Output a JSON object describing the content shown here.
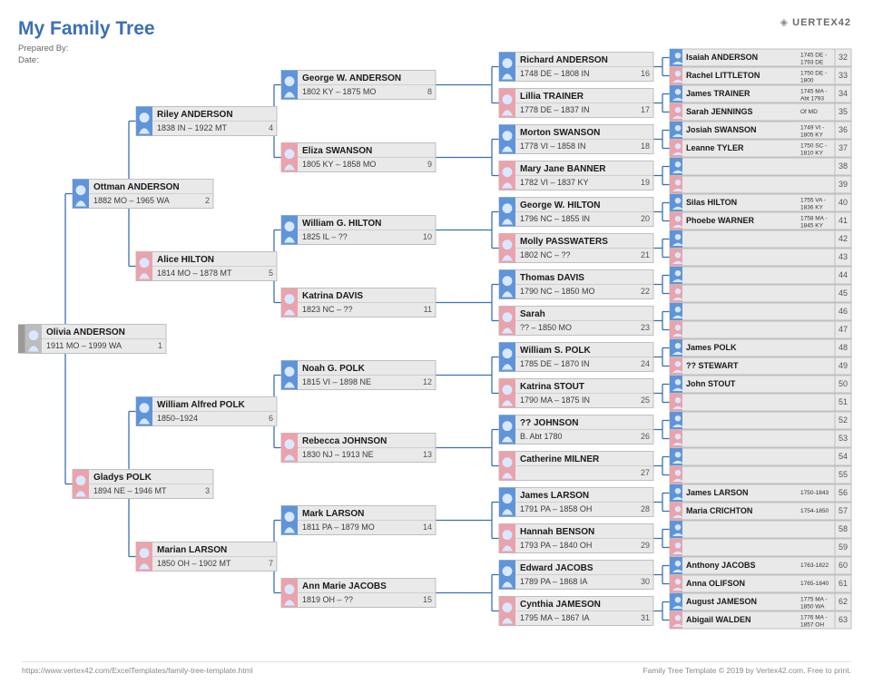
{
  "title": "My Family Tree",
  "meta": {
    "prepared_by_label": "Prepared By:",
    "date_label": "Date:"
  },
  "logo": "UERTEX42",
  "footer_left": "https://www.vertex42.com/ExcelTemplates/family-tree-template.html",
  "footer_right": "Family Tree Template © 2019 by Vertex42.com. Free to print.",
  "gen1": [
    {
      "id": 1,
      "name": "Olivia ANDERSON",
      "dates": "1911 MO – 1999 WA",
      "sex": "n"
    }
  ],
  "gen2": [
    {
      "id": 2,
      "name": "Ottman ANDERSON",
      "dates": "1882 MO – 1965 WA",
      "sex": "m"
    },
    {
      "id": 3,
      "name": "Gladys POLK",
      "dates": "1894 NE – 1946 MT",
      "sex": "f"
    }
  ],
  "gen3": [
    {
      "id": 4,
      "name": "Riley ANDERSON",
      "dates": "1838 IN – 1922 MT",
      "sex": "m"
    },
    {
      "id": 5,
      "name": "Alice HILTON",
      "dates": "1814 MO – 1878 MT",
      "sex": "f"
    },
    {
      "id": 6,
      "name": "William Alfred POLK",
      "dates": "1850–1924",
      "sex": "m"
    },
    {
      "id": 7,
      "name": "Marian LARSON",
      "dates": "1850 OH – 1902 MT",
      "sex": "f"
    }
  ],
  "gen4": [
    {
      "id": 8,
      "name": "George W. ANDERSON",
      "dates": "1802 KY – 1875 MO",
      "sex": "m"
    },
    {
      "id": 9,
      "name": "Eliza SWANSON",
      "dates": "1805 KY – 1858 MO",
      "sex": "f"
    },
    {
      "id": 10,
      "name": "William G. HILTON",
      "dates": "1825 IL – ??",
      "sex": "m"
    },
    {
      "id": 11,
      "name": "Katrina DAVIS",
      "dates": "1823 NC – ??",
      "sex": "f"
    },
    {
      "id": 12,
      "name": "Noah G. POLK",
      "dates": "1815 VI – 1898 NE",
      "sex": "m"
    },
    {
      "id": 13,
      "name": "Rebecca JOHNSON",
      "dates": "1830 NJ – 1913 NE",
      "sex": "f"
    },
    {
      "id": 14,
      "name": "Mark LARSON",
      "dates": "1811 PA – 1879 MO",
      "sex": "m"
    },
    {
      "id": 15,
      "name": "Ann Marie JACOBS",
      "dates": "1819 OH – ??",
      "sex": "f"
    }
  ],
  "gen5": [
    {
      "id": 16,
      "name": "Richard ANDERSON",
      "dates": "1748 DE – 1808 IN",
      "sex": "m"
    },
    {
      "id": 17,
      "name": "Lillia TRAINER",
      "dates": "1778 DE – 1837 IN",
      "sex": "f"
    },
    {
      "id": 18,
      "name": "Morton SWANSON",
      "dates": "1778 VI – 1858 IN",
      "sex": "m"
    },
    {
      "id": 19,
      "name": "Mary Jane BANNER",
      "dates": "1782 VI – 1837 KY",
      "sex": "f"
    },
    {
      "id": 20,
      "name": "George W. HILTON",
      "dates": "1796 NC – 1855 IN",
      "sex": "m"
    },
    {
      "id": 21,
      "name": "Molly PASSWATERS",
      "dates": "1802 NC – ??",
      "sex": "f"
    },
    {
      "id": 22,
      "name": "Thomas DAVIS",
      "dates": "1790 NC – 1850 MO",
      "sex": "m"
    },
    {
      "id": 23,
      "name": "Sarah",
      "dates": "?? – 1850 MO",
      "sex": "f"
    },
    {
      "id": 24,
      "name": "William S. POLK",
      "dates": "1785 DE – 1870 IN",
      "sex": "m"
    },
    {
      "id": 25,
      "name": "Katrina STOUT",
      "dates": "1790 MA – 1875 IN",
      "sex": "f"
    },
    {
      "id": 26,
      "name": "?? JOHNSON",
      "dates": "B. Abt 1780",
      "sex": "m"
    },
    {
      "id": 27,
      "name": "Catherine MILNER",
      "dates": "",
      "sex": "f"
    },
    {
      "id": 28,
      "name": "James LARSON",
      "dates": "1791 PA – 1858 OH",
      "sex": "m"
    },
    {
      "id": 29,
      "name": "Hannah BENSON",
      "dates": "1793 PA – 1840 OH",
      "sex": "f"
    },
    {
      "id": 30,
      "name": "Edward JACOBS",
      "dates": "1789 PA – 1868 IA",
      "sex": "m"
    },
    {
      "id": 31,
      "name": "Cynthia JAMESON",
      "dates": "1795 MA – 1867 IA",
      "sex": "f"
    }
  ],
  "gen6": [
    {
      "id": 32,
      "name": "Isaiah ANDERSON",
      "side": "1745 DE - 1793 DE",
      "sex": "m"
    },
    {
      "id": 33,
      "name": "Rachel LITTLETON",
      "side": "1750 DE - 1800",
      "sex": "f"
    },
    {
      "id": 34,
      "name": "James TRAINER",
      "side": "1745 MA - Abt 1793",
      "sex": "m"
    },
    {
      "id": 35,
      "name": "Sarah JENNINGS",
      "side": "Of MD",
      "sex": "f"
    },
    {
      "id": 36,
      "name": "Josiah SWANSON",
      "side": "1749 VI - 1805 KY",
      "sex": "m"
    },
    {
      "id": 37,
      "name": "Leanne TYLER",
      "side": "1750 SC - 1810 KY",
      "sex": "f"
    },
    {
      "id": 38,
      "name": "",
      "side": "",
      "sex": "m"
    },
    {
      "id": 39,
      "name": "",
      "side": "",
      "sex": "f"
    },
    {
      "id": 40,
      "name": "Silas HILTON",
      "side": "1755 VA - 1836 KY",
      "sex": "m"
    },
    {
      "id": 41,
      "name": "Phoebe WARNER",
      "side": "1758 MA - 1845 KY",
      "sex": "f"
    },
    {
      "id": 42,
      "name": "",
      "side": "",
      "sex": "m"
    },
    {
      "id": 43,
      "name": "",
      "side": "",
      "sex": "f"
    },
    {
      "id": 44,
      "name": "",
      "side": "",
      "sex": "m"
    },
    {
      "id": 45,
      "name": "",
      "side": "",
      "sex": "f"
    },
    {
      "id": 46,
      "name": "",
      "side": "",
      "sex": "m"
    },
    {
      "id": 47,
      "name": "",
      "side": "",
      "sex": "f"
    },
    {
      "id": 48,
      "name": "James POLK",
      "side": "",
      "sex": "m"
    },
    {
      "id": 49,
      "name": "?? STEWART",
      "side": "",
      "sex": "f"
    },
    {
      "id": 50,
      "name": "John STOUT",
      "side": "",
      "sex": "m"
    },
    {
      "id": 51,
      "name": "",
      "side": "",
      "sex": "f"
    },
    {
      "id": 52,
      "name": "",
      "side": "",
      "sex": "m"
    },
    {
      "id": 53,
      "name": "",
      "side": "",
      "sex": "f"
    },
    {
      "id": 54,
      "name": "",
      "side": "",
      "sex": "m"
    },
    {
      "id": 55,
      "name": "",
      "side": "",
      "sex": "f"
    },
    {
      "id": 56,
      "name": "James LARSON",
      "side": "1750-1843",
      "sex": "m"
    },
    {
      "id": 57,
      "name": "Maria CRICHTON",
      "side": "1754-1850",
      "sex": "f"
    },
    {
      "id": 58,
      "name": "",
      "side": "",
      "sex": "m"
    },
    {
      "id": 59,
      "name": "",
      "side": "",
      "sex": "f"
    },
    {
      "id": 60,
      "name": "Anthony JACOBS",
      "side": "1763-1822",
      "sex": "m"
    },
    {
      "id": 61,
      "name": "Anna OLIFSON",
      "side": "1765-1840",
      "sex": "f"
    },
    {
      "id": 62,
      "name": "August JAMESON",
      "side": "1775 MA - 1850 WA",
      "sex": "m"
    },
    {
      "id": 63,
      "name": "Abigail WALDEN",
      "side": "1776 MA - 1857 OH",
      "sex": "f"
    }
  ]
}
